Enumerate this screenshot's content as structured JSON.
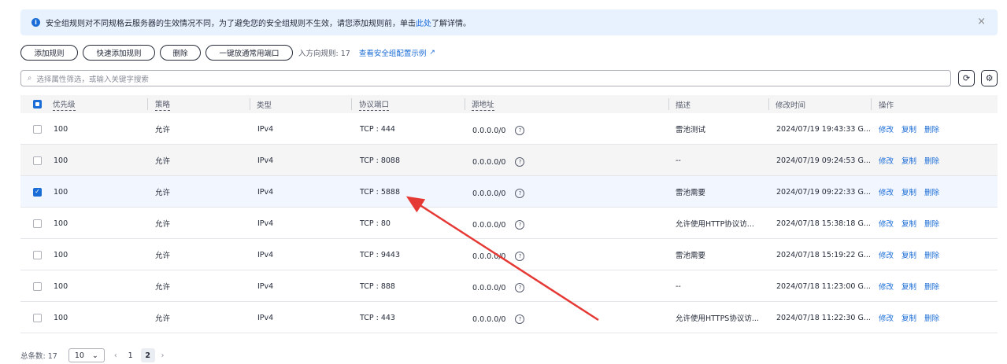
{
  "notice": {
    "text_before": "安全组规则对不同规格云服务器的生效情况不同，为了避免您的安全组规则不生效，请您添加规则前，单击",
    "link": "此处",
    "text_after": "了解详情。",
    "close": "×"
  },
  "toolbar": {
    "add": "添加规则",
    "quick_add": "快速添加规则",
    "delete": "删除",
    "allow_common": "一键放通常用端口",
    "count": "入方向规则: 17",
    "example_link": "查看安全组配置示例"
  },
  "search": {
    "placeholder": "选择属性筛选，或输入关键字搜索"
  },
  "columns": {
    "priority": "优先级",
    "policy": "策略",
    "type": "类型",
    "port": "协议端口",
    "source": "源地址",
    "desc": "描述",
    "modified": "修改时间",
    "ops": "操作"
  },
  "ops": {
    "edit": "修改",
    "copy": "复制",
    "delete": "删除"
  },
  "rows": [
    {
      "priority": "100",
      "policy": "允许",
      "type": "IPv4",
      "port": "TCP : 444",
      "source": "0.0.0.0/0",
      "desc": "雷池测试",
      "modified": "2024/07/19 19:43:33 G...",
      "checked": false
    },
    {
      "priority": "100",
      "policy": "允许",
      "type": "IPv4",
      "port": "TCP : 8088",
      "source": "0.0.0.0/0",
      "desc": "--",
      "modified": "2024/07/19 09:24:53 G...",
      "checked": false
    },
    {
      "priority": "100",
      "policy": "允许",
      "type": "IPv4",
      "port": "TCP : 5888",
      "source": "0.0.0.0/0",
      "desc": "雷池需要",
      "modified": "2024/07/19 09:22:33 G...",
      "checked": true
    },
    {
      "priority": "100",
      "policy": "允许",
      "type": "IPv4",
      "port": "TCP : 80",
      "source": "0.0.0.0/0",
      "desc": "允许使用HTTP协议访...",
      "modified": "2024/07/18 15:38:18 G...",
      "checked": false
    },
    {
      "priority": "100",
      "policy": "允许",
      "type": "IPv4",
      "port": "TCP : 9443",
      "source": "0.0.0.0/0",
      "desc": "雷池需要",
      "modified": "2024/07/18 15:19:22 G...",
      "checked": false
    },
    {
      "priority": "100",
      "policy": "允许",
      "type": "IPv4",
      "port": "TCP : 888",
      "source": "0.0.0.0/0",
      "desc": "--",
      "modified": "2024/07/18 11:23:00 G...",
      "checked": false
    },
    {
      "priority": "100",
      "policy": "允许",
      "type": "IPv4",
      "port": "TCP : 443",
      "source": "0.0.0.0/0",
      "desc": "允许使用HTTPS协议访...",
      "modified": "2024/07/18 11:22:30 G...",
      "checked": false
    }
  ],
  "pager": {
    "total": "总条数: 17",
    "page_size": "10",
    "pages": [
      "1",
      "2"
    ],
    "current": "2"
  },
  "colors": {
    "primary": "#1a6cd6",
    "annotation_arrow": "#e53935"
  }
}
